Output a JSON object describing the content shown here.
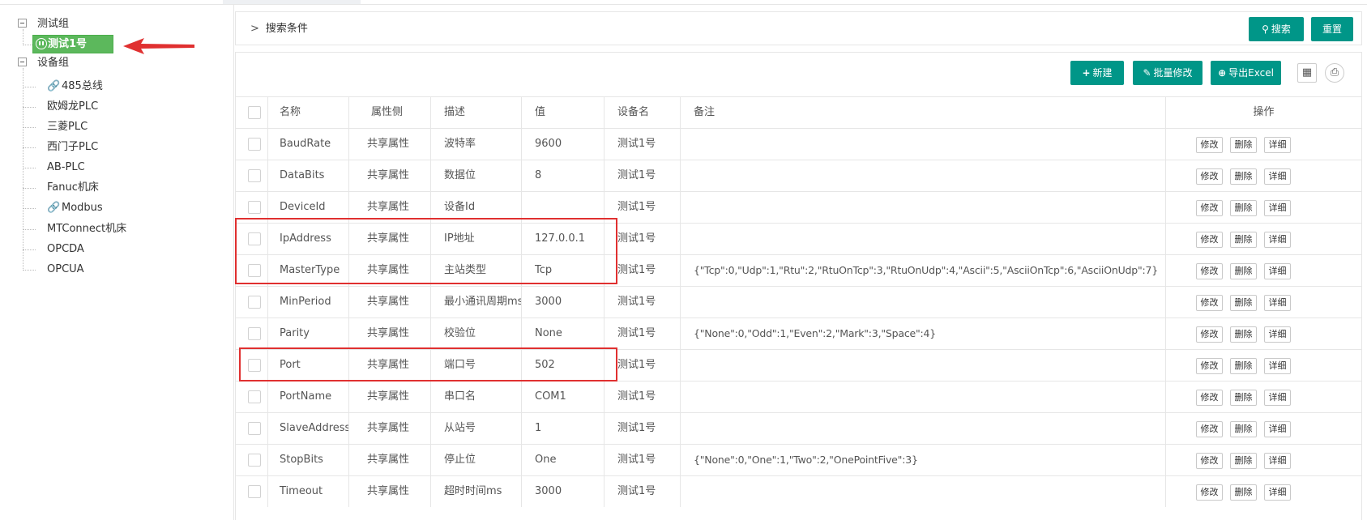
{
  "tree": {
    "groups": [
      {
        "label": "测试组",
        "children": [
          {
            "label": "测试1号",
            "selected": true,
            "icon": "pause-circle-icon"
          }
        ]
      },
      {
        "label": "设备组",
        "children": [
          {
            "label": "485总线",
            "icon": "link-icon"
          },
          {
            "label": "欧姆龙PLC"
          },
          {
            "label": "三菱PLC"
          },
          {
            "label": "西门子PLC"
          },
          {
            "label": "AB-PLC"
          },
          {
            "label": "Fanuc机床"
          },
          {
            "label": "Modbus",
            "icon": "link-icon"
          },
          {
            "label": "MTConnect机床"
          },
          {
            "label": "OPCDA"
          },
          {
            "label": "OPCUA"
          }
        ]
      }
    ]
  },
  "search": {
    "title": "搜索条件",
    "search_label": "搜索",
    "reset_label": "重置"
  },
  "toolbar": {
    "new_label": "新建",
    "batch_edit_label": "批量修改",
    "export_label": "导出Excel"
  },
  "table": {
    "headers": {
      "name": "名称",
      "side": "属性侧",
      "desc": "描述",
      "value": "值",
      "device": "设备名",
      "remark": "备注",
      "ops": "操作"
    },
    "ops": {
      "edit": "修改",
      "delete": "删除",
      "detail": "详细"
    },
    "rows": [
      {
        "name": "BaudRate",
        "side": "共享属性",
        "desc": "波特率",
        "value": "9600",
        "device": "测试1号",
        "remark": ""
      },
      {
        "name": "DataBits",
        "side": "共享属性",
        "desc": "数据位",
        "value": "8",
        "device": "测试1号",
        "remark": ""
      },
      {
        "name": "DeviceId",
        "side": "共享属性",
        "desc": "设备Id",
        "value": "",
        "device": "测试1号",
        "remark": ""
      },
      {
        "name": "IpAddress",
        "side": "共享属性",
        "desc": "IP地址",
        "value": "127.0.0.1",
        "device": "测试1号",
        "remark": ""
      },
      {
        "name": "MasterType",
        "side": "共享属性",
        "desc": "主站类型",
        "value": "Tcp",
        "device": "测试1号",
        "remark": "{\"Tcp\":0,\"Udp\":1,\"Rtu\":2,\"RtuOnTcp\":3,\"RtuOnUdp\":4,\"Ascii\":5,\"AsciiOnTcp\":6,\"AsciiOnUdp\":7}"
      },
      {
        "name": "MinPeriod",
        "side": "共享属性",
        "desc": "最小通讯周期ms",
        "value": "3000",
        "device": "测试1号",
        "remark": ""
      },
      {
        "name": "Parity",
        "side": "共享属性",
        "desc": "校验位",
        "value": "None",
        "device": "测试1号",
        "remark": "{\"None\":0,\"Odd\":1,\"Even\":2,\"Mark\":3,\"Space\":4}"
      },
      {
        "name": "Port",
        "side": "共享属性",
        "desc": "端口号",
        "value": "502",
        "device": "测试1号",
        "remark": ""
      },
      {
        "name": "PortName",
        "side": "共享属性",
        "desc": "串口名",
        "value": "COM1",
        "device": "测试1号",
        "remark": ""
      },
      {
        "name": "SlaveAddress",
        "side": "共享属性",
        "desc": "从站号",
        "value": "1",
        "device": "测试1号",
        "remark": ""
      },
      {
        "name": "StopBits",
        "side": "共享属性",
        "desc": "停止位",
        "value": "One",
        "device": "测试1号",
        "remark": "{\"None\":0,\"One\":1,\"Two\":2,\"OnePointFive\":3}"
      },
      {
        "name": "Timeout",
        "side": "共享属性",
        "desc": "超时时间ms",
        "value": "3000",
        "device": "测试1号",
        "remark": ""
      }
    ]
  },
  "colors": {
    "accent": "#009688",
    "selected": "#5cb85c",
    "highlight": "#e03030"
  }
}
